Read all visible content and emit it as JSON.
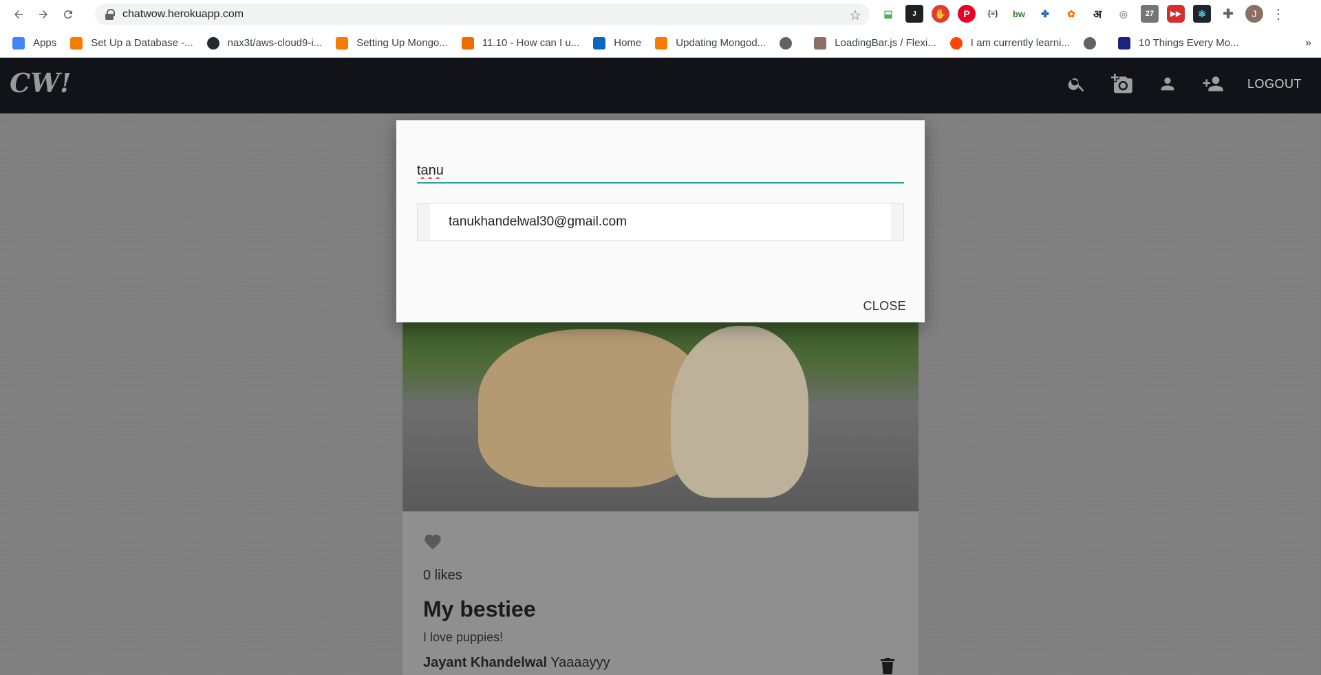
{
  "browser": {
    "url": "chatwow.herokuapp.com",
    "bookmarks": [
      {
        "label": "Apps",
        "icon": "apps-grid-icon",
        "color": "#4285f4"
      },
      {
        "label": "Set Up a Database -...",
        "icon": "cube-icon",
        "color": "#f57c00"
      },
      {
        "label": "nax3t/aws-cloud9-i...",
        "icon": "github-icon",
        "color": "#24292e"
      },
      {
        "label": "Setting Up Mongo...",
        "icon": "cube-icon",
        "color": "#f57c00"
      },
      {
        "label": "11.10 - How can I u...",
        "icon": "ask-icon",
        "color": "#ef6c00"
      },
      {
        "label": "Home",
        "icon": "linkedin-icon",
        "color": "#0a66c2"
      },
      {
        "label": "Updating Mongod...",
        "icon": "cube-icon",
        "color": "#f57c00"
      },
      {
        "label": "",
        "icon": "globe-icon",
        "color": "#5f6368"
      },
      {
        "label": "LoadingBar.js / Flexi...",
        "icon": "codepen-icon",
        "color": "#8d6e63"
      },
      {
        "label": "I am currently learni...",
        "icon": "reddit-icon",
        "color": "#ff4500"
      },
      {
        "label": "",
        "icon": "globe-icon",
        "color": "#5f6368"
      },
      {
        "label": "10 Things Every Mo...",
        "icon": "triangle-icon",
        "color": "#1a237e"
      }
    ],
    "avatar_letter": "J",
    "more": "»"
  },
  "app": {
    "logo": "CW!",
    "logout": "LOGOUT"
  },
  "modal": {
    "search_value": "tanu",
    "result": "tanukhandelwal30@gmail.com",
    "close": "CLOSE"
  },
  "post": {
    "likes": "0 likes",
    "title": "My bestiee",
    "description": "I love puppies!",
    "comment_author": "Jayant Khandelwal",
    "comment_text": "Yaaaayyy"
  }
}
